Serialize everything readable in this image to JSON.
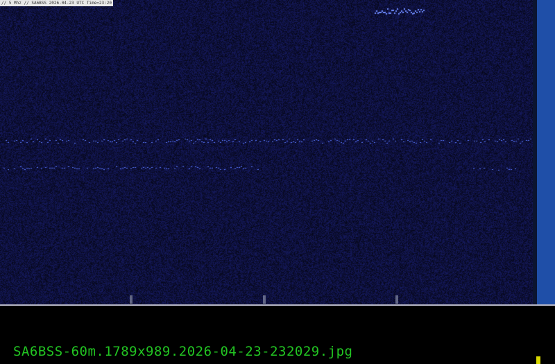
{
  "header": {
    "text": "// 5 Mhz // SA6BSS 2026-04-23 UTC Time=23:20"
  },
  "footer": {
    "filename": "SA6BSS-60m.1789x989.2026-04-23-232029.jpg"
  },
  "colors": {
    "background": "#0a0f3a",
    "signal": "#5a78ff",
    "scale": "#1f4fa8",
    "filename": "#22c422",
    "cursor": "#d8d800"
  }
}
